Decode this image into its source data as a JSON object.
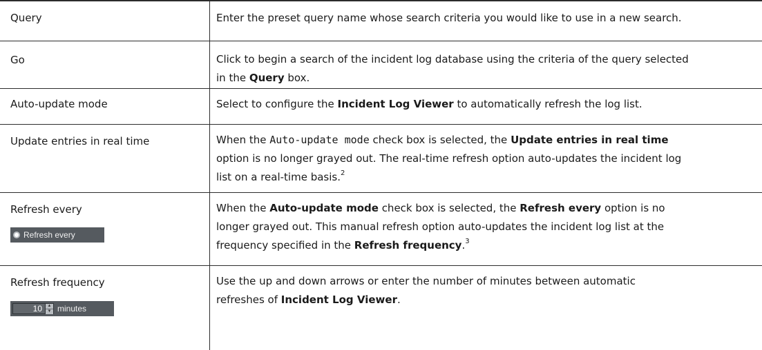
{
  "rows": [
    {
      "label": "Query",
      "description": {
        "l1": "Enter the preset query name whose search criteria you would like to use in a new search."
      }
    },
    {
      "label": "Go",
      "description": {
        "l1": "Click to begin a search of the incident log database using the criteria of the query selected",
        "l2_pre": "in the ",
        "l2_bold": "Query",
        "l2_post": " box."
      }
    },
    {
      "label": "Auto-update mode",
      "description": {
        "pre": "Select to configure the ",
        "bold": "Incident Log Viewer",
        "post": " to automatically refresh the log list."
      }
    },
    {
      "label": "Update entries in real time",
      "description": {
        "l1_pre": "When the ",
        "l1_mono": "Auto-update mode",
        "l1_mid": " check box is selected, the ",
        "l1_bold": "Update entries in real time",
        "l2": "option is no longer grayed out. The real-time refresh option auto-updates the incident log",
        "l3": "list on a real-time basis.",
        "l3_sup": "2"
      }
    },
    {
      "label": "Refresh every",
      "widget_label": "Refresh every",
      "description": {
        "l1_pre": "When the ",
        "l1_bold1": "Auto-update mode",
        "l1_mid": " check box is selected, the ",
        "l1_bold2": "Refresh every",
        "l1_post": " option is no",
        "l2": "longer grayed out. This manual refresh option auto-updates the incident log list at the",
        "l3_pre": "frequency specified in the ",
        "l3_bold": "Refresh frequency",
        "l3_post": ".",
        "l3_sup": "3"
      }
    },
    {
      "label": "Refresh frequency",
      "widget_value": "10",
      "widget_unit": "minutes",
      "description": {
        "l1": "Use the up and down arrows or enter the number of minutes between automatic",
        "l2_pre": "refreshes of ",
        "l2_bold": "Incident Log Viewer",
        "l2_post": "."
      }
    }
  ]
}
